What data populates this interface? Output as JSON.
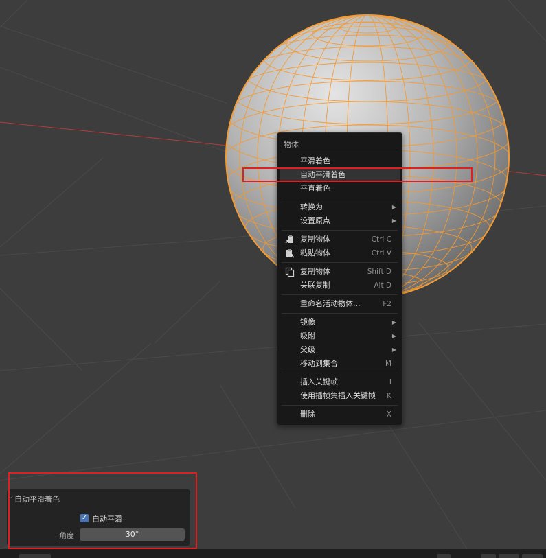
{
  "context_menu": {
    "title": "物体",
    "groups": [
      [
        {
          "label": "平滑着色"
        },
        {
          "label": "自动平滑着色",
          "active": true
        },
        {
          "label": "平直着色"
        }
      ],
      [
        {
          "label": "转换为",
          "submenu": "▶"
        },
        {
          "label": "设置原点",
          "submenu": "▶"
        }
      ],
      [
        {
          "label": "复制物体",
          "shortcut": "Ctrl C",
          "icon": "copy-clipboard-icon"
        },
        {
          "label": "粘贴物体",
          "shortcut": "Ctrl V",
          "icon": "paste-clipboard-icon"
        }
      ],
      [
        {
          "label": "复制物体",
          "shortcut": "Shift D",
          "icon": "duplicate-icon"
        },
        {
          "label": "关联复制",
          "shortcut": "Alt D"
        }
      ],
      [
        {
          "label": "重命名活动物体...",
          "shortcut": "F2"
        }
      ],
      [
        {
          "label": "镜像",
          "submenu": "▶"
        },
        {
          "label": "吸附",
          "submenu": "▶"
        },
        {
          "label": "父级",
          "submenu": "▶"
        },
        {
          "label": "移动到集合",
          "shortcut": "M"
        }
      ],
      [
        {
          "label": "插入关键帧",
          "shortcut": "I"
        },
        {
          "label": "使用插帧集插入关键帧",
          "shortcut": "K"
        }
      ],
      [
        {
          "label": "删除",
          "shortcut": "X"
        }
      ]
    ]
  },
  "operator_panel": {
    "title": "自动平滑着色",
    "caret": "⌵",
    "auto_smooth_label": "自动平滑",
    "auto_smooth_checked": true,
    "check_glyph": "✓",
    "angle_label": "角度",
    "angle_value": "30°"
  },
  "colors": {
    "background": "#3d3d3d",
    "grid": "#4a4a4a",
    "x_axis": "#b83a3a",
    "selection_outline": "#f39a32",
    "highlight_box": "#e02020",
    "checkbox": "#4772b3"
  }
}
